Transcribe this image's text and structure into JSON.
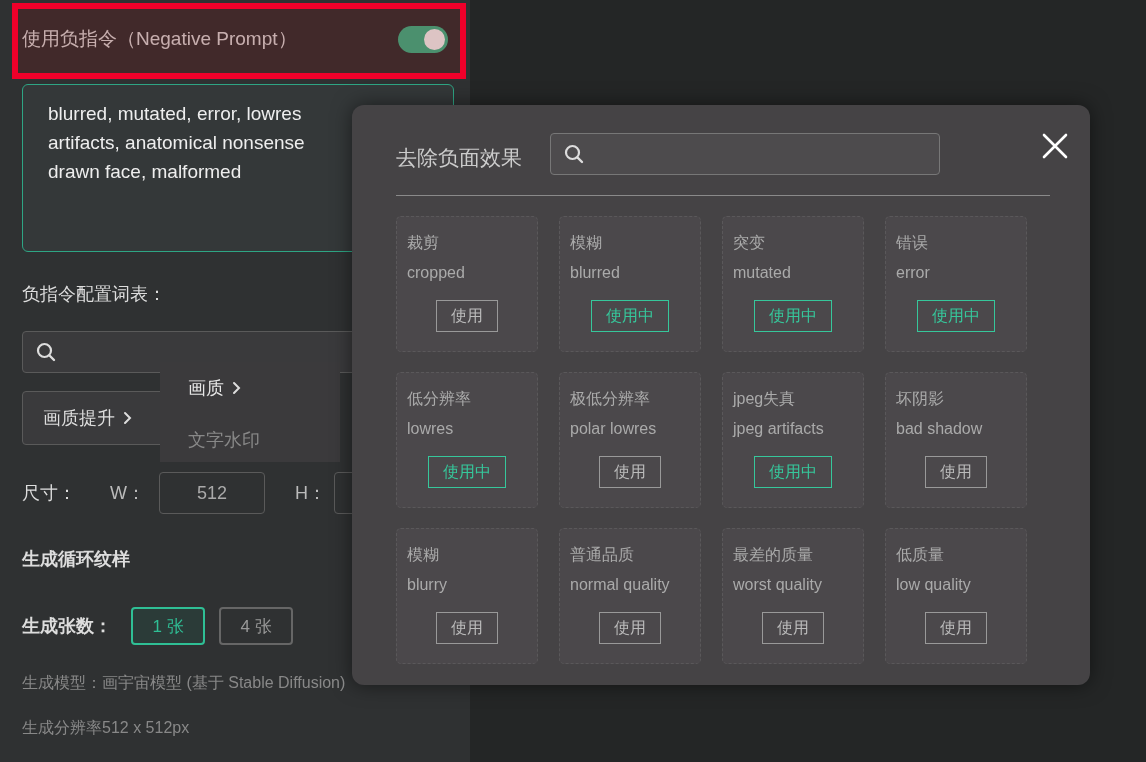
{
  "negative_prompt": {
    "label": "使用负指令（Negative Prompt）",
    "on": true,
    "highlighted": true,
    "text": "blurred, mutated, error, lowres\nartifacts, anatomical nonsense\ndrawn face, malformed"
  },
  "vocab": {
    "label": "负指令配置词表：",
    "categories": [
      {
        "label": "画质提升"
      }
    ]
  },
  "category_menu": {
    "items": [
      {
        "label": "画质",
        "selected": true,
        "submenu": true
      },
      {
        "label": "文字水印",
        "selected": false,
        "submenu": false
      }
    ]
  },
  "size": {
    "label": "尺寸：",
    "width_label": "W：",
    "width_value": "512",
    "height_label": "H："
  },
  "seamless": {
    "label": "生成循环纹样"
  },
  "count": {
    "label": "生成张数：",
    "options": [
      {
        "label": "1 张",
        "selected": true
      },
      {
        "label": "4 张",
        "selected": false
      }
    ]
  },
  "model_info": "生成模型：画宇宙模型 (基于 Stable Diffusion)",
  "resolution_info": "生成分辨率512 x 512px",
  "modal": {
    "title": "去除负面效果",
    "items": [
      {
        "name": "裁剪",
        "term": "cropped",
        "in_use": false,
        "button": "使用"
      },
      {
        "name": "模糊",
        "term": "blurred",
        "in_use": true,
        "button": "使用中"
      },
      {
        "name": "突变",
        "term": "mutated",
        "in_use": true,
        "button": "使用中"
      },
      {
        "name": "错误",
        "term": "error",
        "in_use": true,
        "button": "使用中"
      },
      {
        "name": "低分辨率",
        "term": "lowres",
        "in_use": true,
        "button": "使用中"
      },
      {
        "name": "极低分辨率",
        "term": "polar lowres",
        "in_use": false,
        "button": "使用"
      },
      {
        "name": "jpeg失真",
        "term": "jpeg artifacts",
        "in_use": true,
        "button": "使用中"
      },
      {
        "name": "坏阴影",
        "term": "bad shadow",
        "in_use": false,
        "button": "使用"
      },
      {
        "name": "模糊",
        "term": "blurry",
        "in_use": false,
        "button": "使用"
      },
      {
        "name": "普通品质",
        "term": "normal quality",
        "in_use": false,
        "button": "使用"
      },
      {
        "name": "最差的质量",
        "term": "worst quality",
        "in_use": false,
        "button": "使用"
      },
      {
        "name": "低质量",
        "term": "low quality",
        "in_use": false,
        "button": "使用"
      }
    ]
  }
}
